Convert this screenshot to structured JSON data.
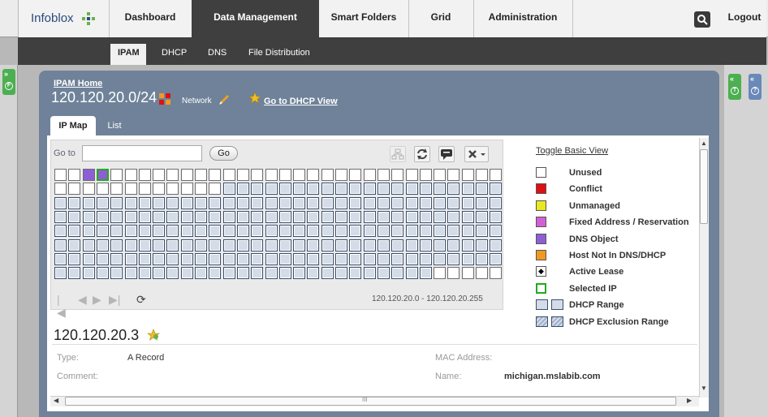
{
  "topnav": {
    "logo": "Infoblox",
    "tabs": [
      "Dashboard",
      "Data Management",
      "Smart Folders",
      "Grid",
      "Administration"
    ],
    "active_tab": "Data Management",
    "logout": "Logout"
  },
  "subnav": {
    "tabs": [
      "IPAM",
      "DHCP",
      "DNS",
      "File Distribution"
    ],
    "active_tab": "IPAM"
  },
  "header": {
    "breadcrumb": "IPAM Home",
    "network": "120.120.20.0/24",
    "network_label": "Network",
    "goto_dhcp": "Go to DHCP View"
  },
  "view_tabs": [
    "IP Map",
    "List"
  ],
  "ipmap": {
    "goto_label": "Go to",
    "goto_value": "",
    "goto_button": "Go",
    "range_label": "120.120.20.0 - 120.120.20.255",
    "columns": 32,
    "rows": 8,
    "range_start": 44,
    "range_end": 250,
    "dns_cells": [
      2
    ],
    "selected_cell": 3
  },
  "legend": {
    "toggle": "Toggle Basic View",
    "items": [
      {
        "label": "Unused",
        "color": "#ffffff",
        "kind": "plain"
      },
      {
        "label": "Conflict",
        "color": "#dd1111",
        "kind": "plain"
      },
      {
        "label": "Unmanaged",
        "color": "#e8e820",
        "kind": "plain"
      },
      {
        "label": "Fixed Address / Reservation",
        "color": "#d45fd4",
        "kind": "plain"
      },
      {
        "label": "DNS Object",
        "color": "#8e5fd4",
        "kind": "plain"
      },
      {
        "label": "Host Not In DNS/DHCP",
        "color": "#f09a22",
        "kind": "plain"
      },
      {
        "label": "Active Lease",
        "color": "#ffffff",
        "kind": "diamond"
      },
      {
        "label": "Selected IP",
        "color": "#ffffff",
        "kind": "selected"
      },
      {
        "label": "DHCP Range",
        "color": "#d4dce8",
        "kind": "range"
      },
      {
        "label": "DHCP Exclusion Range",
        "color": "#9fb3cf",
        "kind": "exclusion"
      }
    ]
  },
  "details": {
    "ip": "120.120.20.3",
    "type_label": "Type:",
    "type_value": "A Record",
    "comment_label": "Comment:",
    "mac_label": "MAC Address:",
    "name_label": "Name:",
    "name_value": "michigan.mslabib.com"
  },
  "colors": {
    "panel": "#6f8299",
    "nav_dark": "#3f3f3f",
    "side_green": "#4caf50",
    "side_blue": "#6a88b8"
  },
  "scroll": {
    "hscroll_marker": "III"
  }
}
